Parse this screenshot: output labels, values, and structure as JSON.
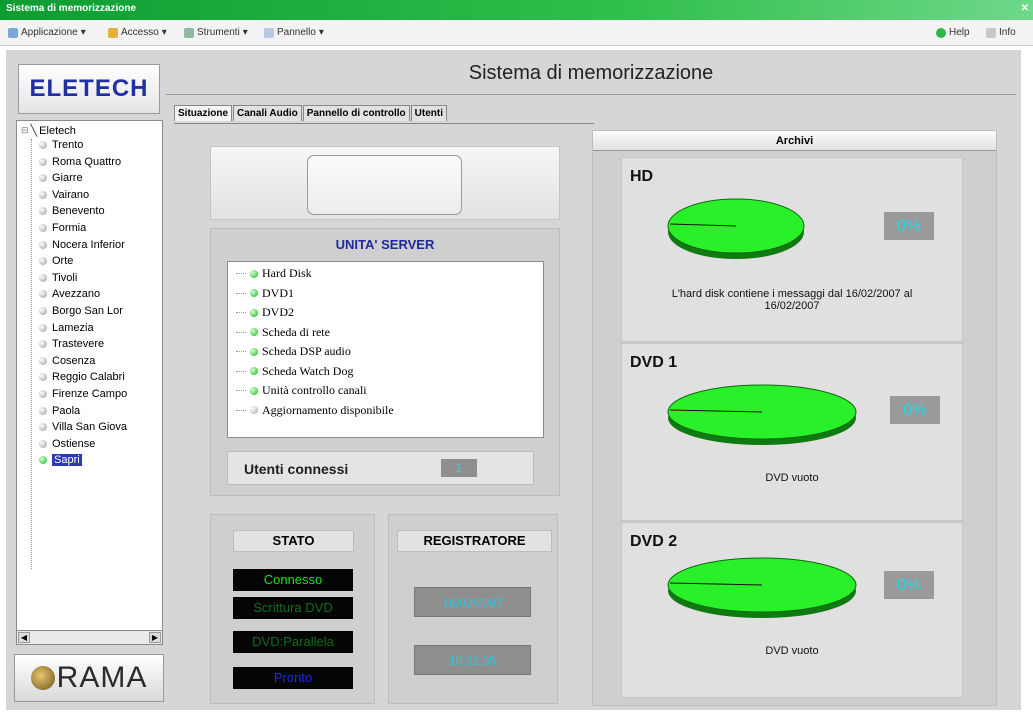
{
  "window": {
    "title": "Sistema di memorizzazione"
  },
  "menubar": {
    "items": [
      "Applicazione",
      "Accesso",
      "Strumenti",
      "Pannello"
    ],
    "help": "Help",
    "info": "Info"
  },
  "brand": {
    "logo": "ELETECH",
    "footer_logo": "RAMA"
  },
  "tree": {
    "root": "Eletech",
    "nodes": [
      {
        "label": "Trento",
        "active": false
      },
      {
        "label": "Roma Quattro",
        "active": false
      },
      {
        "label": "Giarre",
        "active": false
      },
      {
        "label": "Vairano",
        "active": false
      },
      {
        "label": "Benevento",
        "active": false
      },
      {
        "label": "Formia",
        "active": false
      },
      {
        "label": "Nocera Inferior",
        "active": false
      },
      {
        "label": "Orte",
        "active": false
      },
      {
        "label": "Tivoli",
        "active": false
      },
      {
        "label": "Avezzano",
        "active": false
      },
      {
        "label": "Borgo San Lor",
        "active": false
      },
      {
        "label": "Lamezia",
        "active": false
      },
      {
        "label": "Trastevere",
        "active": false
      },
      {
        "label": "Cosenza",
        "active": false
      },
      {
        "label": "Reggio Calabri",
        "active": false
      },
      {
        "label": "Firenze Campo",
        "active": false
      },
      {
        "label": "Paola",
        "active": false
      },
      {
        "label": "Villa San Giova",
        "active": false
      },
      {
        "label": "Ostiense",
        "active": false
      },
      {
        "label": "Sapri",
        "active": true
      }
    ]
  },
  "main": {
    "title": "Sistema di memorizzazione",
    "tabs": [
      "Situazione",
      "Canali Audio",
      "Pannello di controllo",
      "Utenti"
    ]
  },
  "server": {
    "title": "UNITA' SERVER",
    "items": [
      {
        "label": "Hard Disk",
        "ok": true
      },
      {
        "label": "DVD1",
        "ok": true
      },
      {
        "label": "DVD2",
        "ok": true
      },
      {
        "label": "Scheda di rete",
        "ok": true
      },
      {
        "label": "Scheda DSP audio",
        "ok": true
      },
      {
        "label": "Scheda Watch Dog",
        "ok": true
      },
      {
        "label": "Unità controllo canali",
        "ok": true
      },
      {
        "label": "Aggiornamento disponibile",
        "ok": false
      }
    ],
    "users_label": "Utenti connessi",
    "users_value": "1"
  },
  "stato": {
    "title": "STATO",
    "lines": [
      {
        "text": "Connesso",
        "color": "#19e019"
      },
      {
        "text": "Scrittura DVD",
        "color": "#0f6e1a"
      },
      {
        "text": "DVD:Parallela",
        "color": "#0f6e1a"
      },
      {
        "text": "Pronto",
        "color": "#1b2ee6"
      }
    ]
  },
  "registratore": {
    "title": "REGISTRATORE",
    "date": "16/02/2007",
    "time": "10:32:35"
  },
  "archivi": {
    "title": "Archivi",
    "disks": [
      {
        "label": "HD",
        "percent_text": "0%",
        "percent": 0,
        "description": "L'hard disk contiene i messaggi dal 16/02/2007 al 16/02/2007"
      },
      {
        "label": "DVD 1",
        "percent_text": "0%",
        "percent": 0,
        "description": "DVD vuoto"
      },
      {
        "label": "DVD 2",
        "percent_text": "0%",
        "percent": 0,
        "description": "DVD vuoto"
      }
    ]
  },
  "colors": {
    "accent_green": "#18d818",
    "brand_blue": "#1f2fa8",
    "value_cyan": "#2dd3e6"
  }
}
